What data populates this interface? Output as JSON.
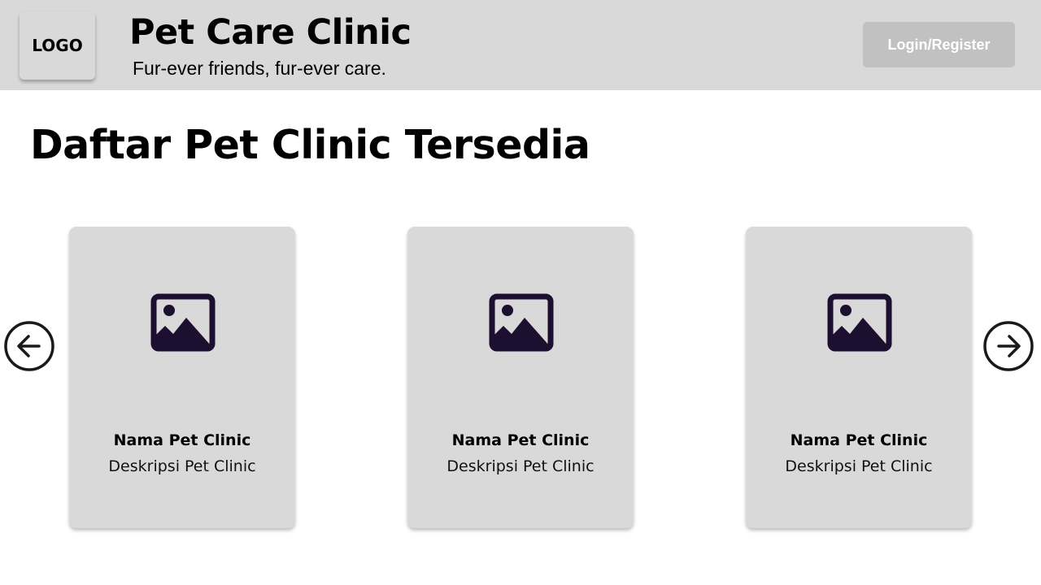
{
  "header": {
    "logo_text": "LOGO",
    "title": "Pet Care Clinic",
    "tagline": "Fur-ever friends, fur-ever care.",
    "login_label": "Login/Register"
  },
  "main": {
    "title": "Daftar Pet Clinic Tersedia",
    "carousel": {
      "prev_icon": "arrow-left-circle-icon",
      "next_icon": "arrow-right-circle-icon",
      "cards": [
        {
          "image_icon": "image-placeholder-icon",
          "name": "Nama Pet Clinic",
          "description": "Deskripsi Pet Clinic"
        },
        {
          "image_icon": "image-placeholder-icon",
          "name": "Nama Pet Clinic",
          "description": "Deskripsi Pet Clinic"
        },
        {
          "image_icon": "image-placeholder-icon",
          "name": "Nama Pet Clinic",
          "description": "Deskripsi Pet Clinic"
        }
      ]
    }
  },
  "colors": {
    "header_bg": "#d9d9d9",
    "card_bg": "#d9d9d9",
    "button_bg": "#c1c1c1",
    "icon_color": "#1c0f30"
  }
}
